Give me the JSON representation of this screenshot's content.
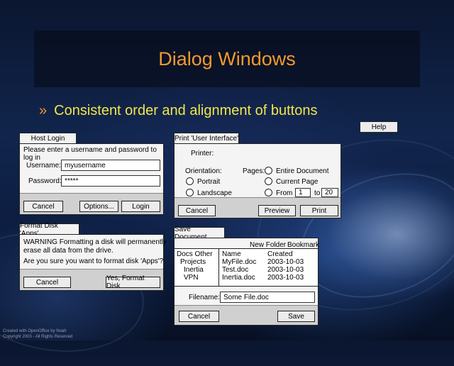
{
  "slide": {
    "title": "Dialog Windows",
    "bullet_mark": "»",
    "bullet": "Consistent order and alignment of buttons",
    "help": "Help",
    "credit_line1": "Created with OpenOffice by Noah",
    "credit_line2": "Copyright 2003 - All Rights Reserved"
  },
  "host_login": {
    "tab": "Host Login",
    "prompt": "Please enter a username and password to log in",
    "username_label": "Username:",
    "username_value": "myusername",
    "password_label": "Password:",
    "password_value": "*****",
    "cancel": "Cancel",
    "options": "Options...",
    "login": "Login"
  },
  "format_disk": {
    "tab": "Format Disk 'Apps'",
    "warning_line1": "WARNING  Formatting a disk will permanently",
    "warning_line2": "erase all data from the drive.",
    "question": "Are you sure you want to format disk 'Apps'?",
    "cancel": "Cancel",
    "confirm": "Yes, Format Disk"
  },
  "print": {
    "tab": "Print 'User Interface'",
    "printer_label": "Printer:",
    "orientation_label": "Orientation:",
    "portrait": "Portrait",
    "landscape": "Landscape",
    "pages_label": "Pages:",
    "entire": "Entire Document",
    "current": "Current Page",
    "from": "From",
    "from_value": "1",
    "to": "to",
    "to_value": "20",
    "cancel": "Cancel",
    "preview": "Preview",
    "print": "Print"
  },
  "save": {
    "tab": "Save Document",
    "new_folder": "New Folder",
    "bookmark": "Bookmark",
    "folders_header": "Docs  Other",
    "folders": [
      "Projects",
      "Inertia",
      "VPN"
    ],
    "col_name": "Name",
    "col_created": "Created",
    "files": [
      {
        "name": "MyFile.doc",
        "created": "2003-10-03"
      },
      {
        "name": "Test.doc",
        "created": "2003-10-03"
      },
      {
        "name": "Inertia.doc",
        "created": "2003-10-03"
      }
    ],
    "filename_label": "Filename:",
    "filename_value": "Some File.doc",
    "cancel": "Cancel",
    "save": "Save"
  }
}
